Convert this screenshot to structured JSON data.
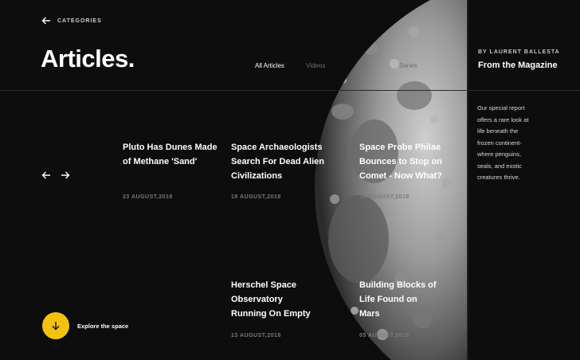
{
  "nav": {
    "back_label": "CATEGORIES"
  },
  "header": {
    "title": "Articles."
  },
  "tabs": [
    {
      "label": "All Articles",
      "active": true
    },
    {
      "label": "Videos",
      "active": false
    },
    {
      "label": "",
      "active": false
    },
    {
      "label": "Series",
      "active": false
    }
  ],
  "aside": {
    "author": "BY LAURENT BALLESTA",
    "heading": "From the Magazine",
    "body": "Our special report offers a rare look at life beneath the frozen continent-where penguins, seals, and exotic creatures thrive."
  },
  "articles": [
    {
      "title": "Pluto Has Dunes Made of Methane 'Sand'",
      "date": "23 AUGUST,2018"
    },
    {
      "title": "Space Archaeologists Search For Dead Alien Civilizations",
      "date": "19 AUGUST,2018"
    },
    {
      "title": "Space Probe Philae Bounces to Stop on Comet - Now What?",
      "date": "18 AUGUST,2018"
    },
    {
      "title": "Herschel Space Observatory Running On Empty",
      "date": "13 AUGUST,2018"
    },
    {
      "title": "Building Blocks of Life Found on Mars",
      "date": "05 AUGUST,2018"
    }
  ],
  "explore": {
    "label": "Explore the space"
  },
  "colors": {
    "accent": "#f3c211",
    "background": "#0d0d0d"
  }
}
